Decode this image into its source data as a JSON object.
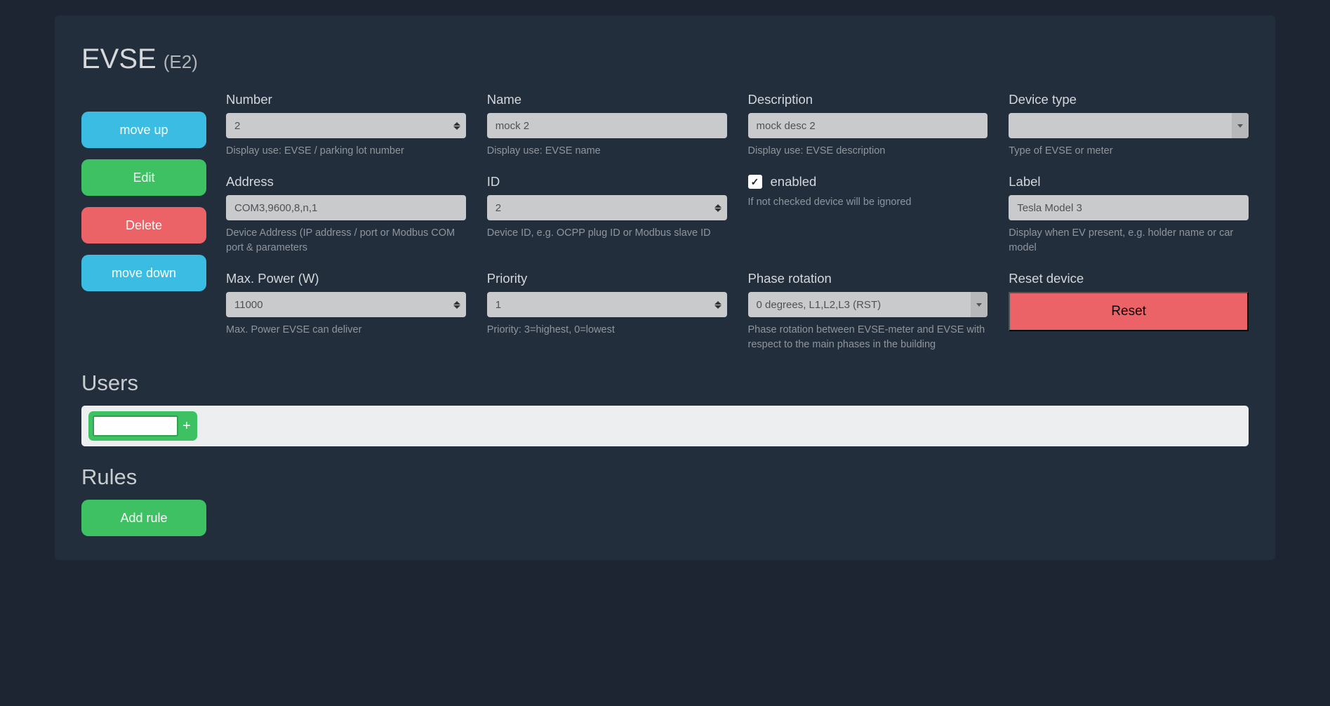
{
  "header": {
    "title": "EVSE",
    "subtitle": "(E2)"
  },
  "sidebar": {
    "move_up": "move up",
    "edit": "Edit",
    "delete": "Delete",
    "move_down": "move down"
  },
  "fields": {
    "number": {
      "label": "Number",
      "value": "2",
      "help": "Display use: EVSE / parking lot number"
    },
    "name": {
      "label": "Name",
      "value": "mock 2",
      "help": "Display use: EVSE name"
    },
    "description": {
      "label": "Description",
      "value": "mock desc 2",
      "help": "Display use: EVSE description"
    },
    "device_type": {
      "label": "Device type",
      "value": "",
      "help": "Type of EVSE or meter"
    },
    "address": {
      "label": "Address",
      "value": "COM3,9600,8,n,1",
      "help": "Device Address (IP address / port or Modbus COM port & parameters"
    },
    "id": {
      "label": "ID",
      "value": "2",
      "help": "Device ID, e.g. OCPP plug ID or Modbus slave ID"
    },
    "enabled": {
      "label": "enabled",
      "checked": true,
      "help": "If not checked device will be ignored"
    },
    "label_field": {
      "label": "Label",
      "value": "Tesla Model 3",
      "help": "Display when EV present, e.g. holder name or car model"
    },
    "max_power": {
      "label": "Max. Power (W)",
      "value": "11000",
      "help": "Max. Power EVSE can deliver"
    },
    "priority": {
      "label": "Priority",
      "value": "1",
      "help": "Priority: 3=highest, 0=lowest"
    },
    "phase_rotation": {
      "label": "Phase rotation",
      "value": "0 degrees, L1,L2,L3 (RST)",
      "help": "Phase rotation between EVSE-meter and EVSE with respect to the main phases in the building"
    },
    "reset": {
      "label": "Reset device",
      "button": "Reset"
    }
  },
  "users": {
    "title": "Users",
    "add_icon": "+"
  },
  "rules": {
    "title": "Rules",
    "add_button": "Add rule"
  }
}
